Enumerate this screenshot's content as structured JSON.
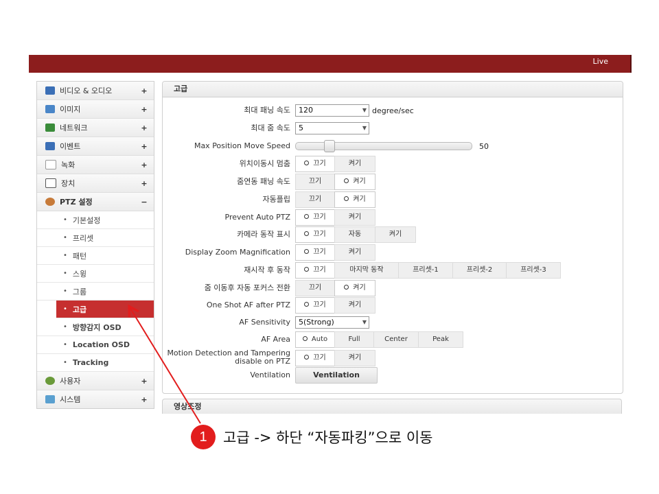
{
  "topbar": {
    "live_label": "Live"
  },
  "sidebar": {
    "items": [
      {
        "label": "비디오 & 오디오",
        "toggle": "+",
        "icon": "video-audio-icon",
        "color": "#3b6fb6"
      },
      {
        "label": "이미지",
        "toggle": "+",
        "icon": "image-icon",
        "color": "#4a86c8"
      },
      {
        "label": "네트워크",
        "toggle": "+",
        "icon": "network-icon",
        "color": "#3a8c3a"
      },
      {
        "label": "이벤트",
        "toggle": "+",
        "icon": "event-icon",
        "color": "#3b6fb6"
      },
      {
        "label": "녹화",
        "toggle": "+",
        "icon": "record-icon",
        "color": "#999999"
      },
      {
        "label": "장치",
        "toggle": "+",
        "icon": "device-icon",
        "color": "#555555"
      },
      {
        "label": "PTZ 설정",
        "toggle": "−",
        "icon": "ptz-icon",
        "color": "#c77b3a"
      }
    ],
    "ptz_sub": [
      "기본설정",
      "프리셋",
      "패턴",
      "스윙",
      "그룹",
      "고급",
      "방향감지 OSD",
      "Location OSD",
      "Tracking"
    ],
    "bullet": "•",
    "bottom_items": [
      {
        "label": "사용자",
        "toggle": "+",
        "icon": "user-icon",
        "color": "#6a9a3a"
      },
      {
        "label": "시스템",
        "toggle": "+",
        "icon": "system-icon",
        "color": "#5aa0d0"
      }
    ]
  },
  "panel": {
    "title": "고급",
    "max_pan_speed": {
      "label": "최대 패닝 속도",
      "value": "120",
      "unit": "degree/sec"
    },
    "max_zoom_speed": {
      "label": "최대 줌 속도",
      "value": "5"
    },
    "max_pos_speed": {
      "label": "Max Position Move Speed",
      "value": "50",
      "level_percent": 17
    },
    "rows": {
      "pos_stop": {
        "label": "위치이동시 멈춤",
        "opts": [
          "끄기",
          "켜기"
        ],
        "selected": 0
      },
      "zoom_pan": {
        "label": "줌연동 패닝 속도",
        "opts": [
          "끄기",
          "켜기"
        ],
        "selected": 1
      },
      "auto_flip": {
        "label": "자동플립",
        "opts": [
          "끄기",
          "켜기"
        ],
        "selected": 1
      },
      "prevent_auto": {
        "label": "Prevent Auto PTZ",
        "opts": [
          "끄기",
          "켜기"
        ],
        "selected": 0
      },
      "cam_op": {
        "label": "카메라 동작 표시",
        "opts": [
          "끄기",
          "자동",
          "켜기"
        ],
        "selected": 0
      },
      "zoom_mag": {
        "label": "Display Zoom Magnification",
        "opts": [
          "끄기",
          "켜기"
        ],
        "selected": 0
      },
      "restart": {
        "label": "재시작 후 동작",
        "opts": [
          "끄기",
          "마지막 동작",
          "프리셋-1",
          "프리셋-2",
          "프리셋-3"
        ],
        "selected": 0
      },
      "autofocus": {
        "label": "줌 이동후 자동 포커스 전환",
        "opts": [
          "끄기",
          "켜기"
        ],
        "selected": 1
      },
      "oneshot": {
        "label": "One Shot AF after PTZ",
        "opts": [
          "끄기",
          "켜기"
        ],
        "selected": 0
      },
      "af_area": {
        "label": "AF Area",
        "opts": [
          "Auto",
          "Full",
          "Center",
          "Peak"
        ],
        "selected": 0
      },
      "motion": {
        "label_line1": "Motion Detection and Tampering",
        "label_line2": "disable on PTZ",
        "opts": [
          "끄기",
          "켜기"
        ],
        "selected": 0
      }
    },
    "af_sensitivity": {
      "label": "AF Sensitivity",
      "value": "5(Strong)"
    },
    "ventilation": {
      "label": "Ventilation",
      "button": "Ventilation"
    }
  },
  "panel2": {
    "title": "영상조정"
  },
  "annotation": {
    "number": "1",
    "text": "고급 -> 하단 “자동파킹”으로 이동",
    "color": "#e21d1d"
  }
}
